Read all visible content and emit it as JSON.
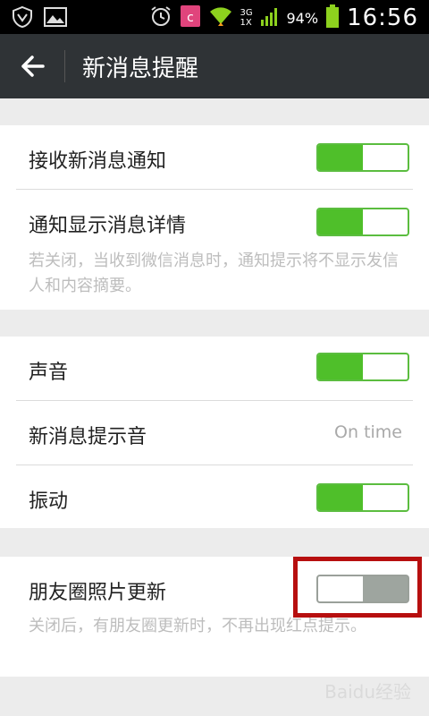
{
  "status_bar": {
    "battery_percent": "94%",
    "time": "16:56",
    "network": "3G 1X",
    "icons": [
      "shield-v-icon",
      "gallery-icon",
      "alarm-icon",
      "app-c-icon",
      "wifi-icon",
      "signal-icon",
      "battery-icon"
    ]
  },
  "action_bar": {
    "title": "新消息提醒"
  },
  "group1": {
    "item1": {
      "label": "接收新消息通知",
      "enabled": true
    },
    "item2": {
      "label": "通知显示消息详情",
      "enabled": true
    },
    "description": "若关闭，当收到微信消息时，通知提示将不显示发信人和内容摘要。"
  },
  "group2": {
    "sound": {
      "label": "声音",
      "enabled": true
    },
    "ringtone": {
      "label": "新消息提示音",
      "value": "On time"
    },
    "vibrate": {
      "label": "振动",
      "enabled": true
    }
  },
  "group3": {
    "moments": {
      "label": "朋友圈照片更新",
      "enabled": false
    },
    "description": "关闭后，有朋友圈更新时，不再出现红点提示。"
  },
  "colors": {
    "accent_green": "#4fbf2a",
    "highlight_red": "#b70f0f",
    "action_bar": "#2f3336"
  },
  "watermark": "Baidu经验"
}
